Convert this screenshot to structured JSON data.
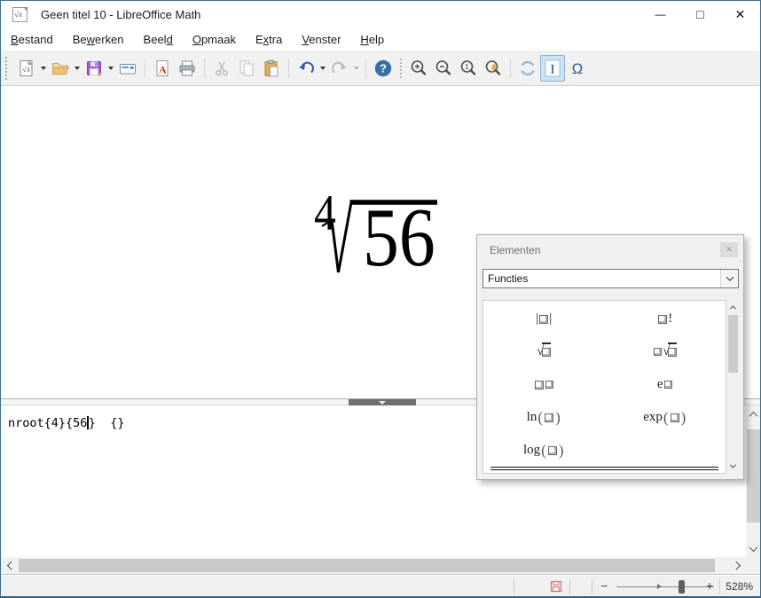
{
  "app": {
    "title": "Geen titel 10 - LibreOffice Math"
  },
  "icons": {
    "sqrt_x": "√x",
    "pdf_a": "A",
    "help": "?",
    "one": "1",
    "ibeam": "I",
    "omega": "Ω",
    "minus": "−",
    "plus": "+",
    "close": "✕",
    "minimize": "—",
    "maximize": "□"
  },
  "menu": {
    "items": [
      {
        "pre": "",
        "ul": "B",
        "post": "estand"
      },
      {
        "pre": "Be",
        "ul": "w",
        "post": "erken"
      },
      {
        "pre": "Beel",
        "ul": "d",
        "post": ""
      },
      {
        "pre": "",
        "ul": "O",
        "post": "pmaak"
      },
      {
        "pre": "E",
        "ul": "x",
        "post": "tra"
      },
      {
        "pre": "",
        "ul": "V",
        "post": "enster"
      },
      {
        "pre": "",
        "ul": "H",
        "post": "elp"
      }
    ]
  },
  "toolbar": {
    "icon_names": [
      "new-formula",
      "open",
      "save",
      "email",
      "export-pdf",
      "print",
      "cut",
      "copy",
      "paste",
      "undo",
      "redo",
      "help",
      "zoom-in",
      "zoom-out",
      "zoom-100",
      "show-all",
      "refresh",
      "formula-cursor",
      "symbols"
    ]
  },
  "formula": {
    "index": "4",
    "radicand": "56"
  },
  "command_editor": {
    "before_caret": "nroot{4}{56",
    "after_caret": "}  {}"
  },
  "panel": {
    "title": "Elementen",
    "category": "Functies",
    "items": [
      {
        "name": "absolute-value",
        "tokens": [
          {
            "t": "txt",
            "v": "|"
          },
          {
            "t": "box"
          },
          {
            "t": "txt",
            "v": "|"
          }
        ]
      },
      {
        "name": "factorial",
        "tokens": [
          {
            "t": "box"
          },
          {
            "t": "txt",
            "v": "!"
          }
        ]
      },
      {
        "name": "square-root",
        "tokens": [
          {
            "t": "txt",
            "v": "√"
          },
          {
            "t": "barbox"
          }
        ]
      },
      {
        "name": "nth-root",
        "tokens": [
          {
            "t": "supbox"
          },
          {
            "t": "txt",
            "v": "√"
          },
          {
            "t": "barbox"
          }
        ]
      },
      {
        "name": "power",
        "tokens": [
          {
            "t": "box"
          },
          {
            "t": "supbox"
          }
        ]
      },
      {
        "name": "e-power",
        "tokens": [
          {
            "t": "txt",
            "v": "e"
          },
          {
            "t": "supbox"
          }
        ]
      },
      {
        "name": "natural-logarithm",
        "tokens": [
          {
            "t": "txt",
            "v": "ln"
          },
          {
            "t": "paren",
            "v": "("
          },
          {
            "t": "box"
          },
          {
            "t": "paren",
            "v": ")"
          }
        ]
      },
      {
        "name": "exp-function",
        "tokens": [
          {
            "t": "txt",
            "v": "exp"
          },
          {
            "t": "paren",
            "v": "("
          },
          {
            "t": "box"
          },
          {
            "t": "paren",
            "v": ")"
          }
        ]
      },
      {
        "name": "logarithm",
        "tokens": [
          {
            "t": "txt",
            "v": "log"
          },
          {
            "t": "paren",
            "v": "("
          },
          {
            "t": "box"
          },
          {
            "t": "paren",
            "v": ")"
          }
        ]
      }
    ]
  },
  "statusbar": {
    "zoom_level": "528%"
  }
}
